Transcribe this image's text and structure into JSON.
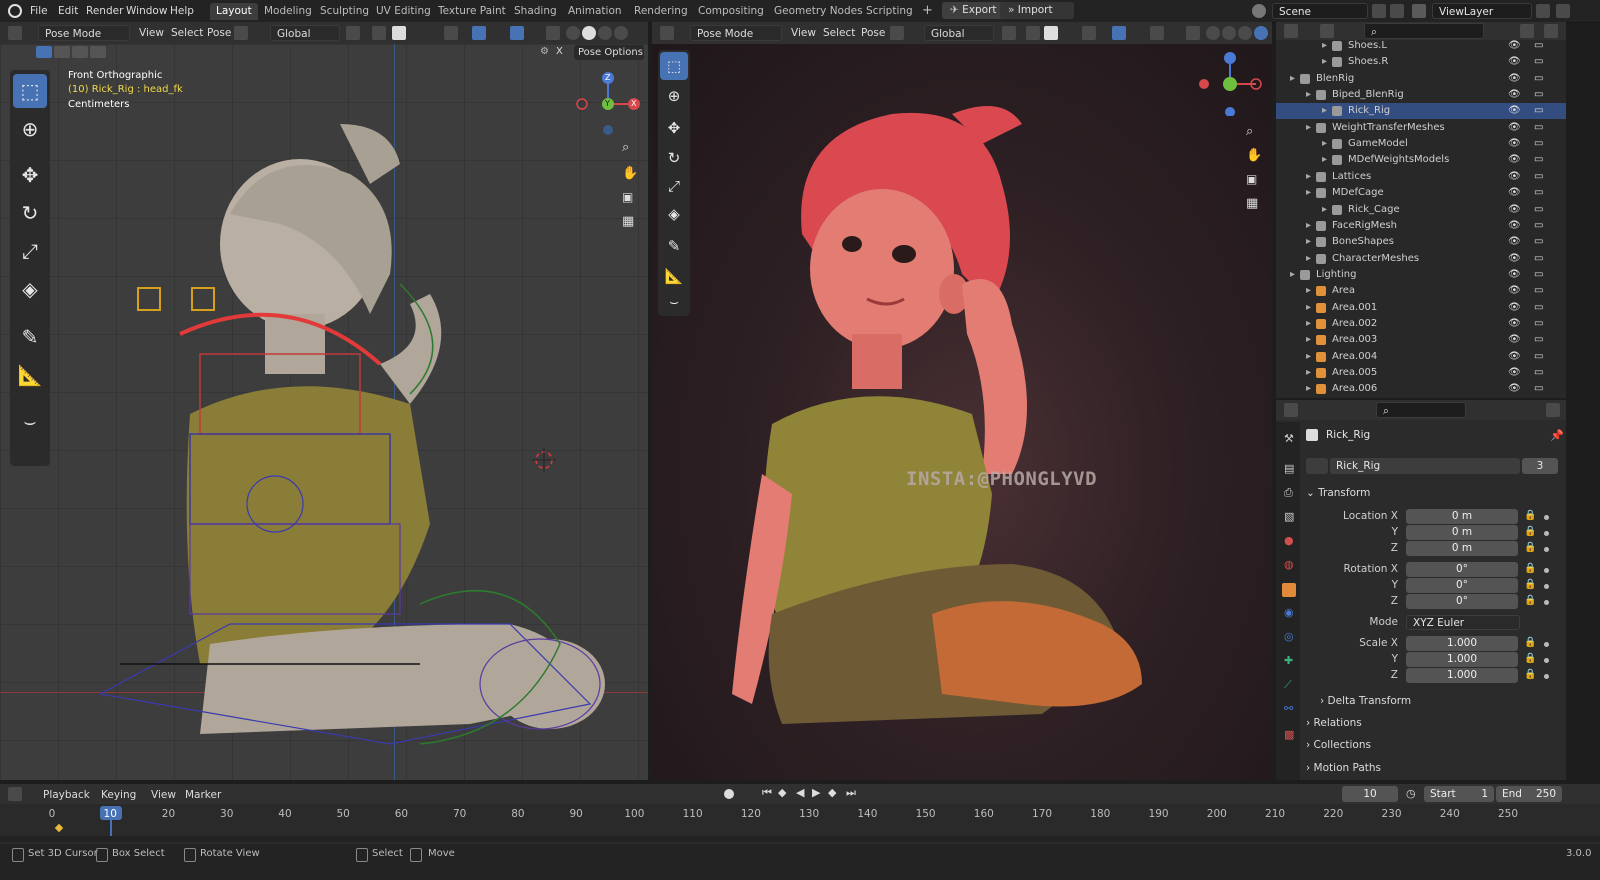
{
  "menu": [
    "File",
    "Edit",
    "Render",
    "Window",
    "Help"
  ],
  "workspaces": [
    "Layout",
    "Modeling",
    "Sculpting",
    "UV Editing",
    "Texture Paint",
    "Shading",
    "Animation",
    "Rendering",
    "Compositing",
    "Geometry Nodes",
    "Scripting"
  ],
  "export_label": "Export",
  "import_label": "Import",
  "scene": "Scene",
  "view_layer": "ViewLayer",
  "left_header": {
    "mode": "Pose Mode",
    "view": "View",
    "select": "Select",
    "pose": "Pose",
    "orientation": "Global"
  },
  "right_header": {
    "mode": "Pose Mode",
    "view": "View",
    "select": "Select",
    "pose": "Pose",
    "orientation": "Global"
  },
  "pose_options": "Pose Options",
  "viewport_info": {
    "view": "Front Orthographic",
    "object": "(10) Rick_Rig : head_fk",
    "units": "Centimeters"
  },
  "watermark": "INSTA:@PHONGLYVD",
  "gizmo": {
    "x": "X",
    "y": "Y",
    "z": "Z"
  },
  "outliner": [
    {
      "name": "Shoes.L",
      "indent": 3
    },
    {
      "name": "Shoes.R",
      "indent": 3
    },
    {
      "name": "BlenRig",
      "indent": 1
    },
    {
      "name": "Biped_BlenRig",
      "indent": 2
    },
    {
      "name": "Rick_Rig",
      "indent": 3,
      "selected": true
    },
    {
      "name": "WeightTransferMeshes",
      "indent": 2
    },
    {
      "name": "GameModel",
      "indent": 3
    },
    {
      "name": "MDefWeightsModels",
      "indent": 3
    },
    {
      "name": "Lattices",
      "indent": 2
    },
    {
      "name": "MDefCage",
      "indent": 2
    },
    {
      "name": "Rick_Cage",
      "indent": 3
    },
    {
      "name": "FaceRigMesh",
      "indent": 2
    },
    {
      "name": "BoneShapes",
      "indent": 2
    },
    {
      "name": "CharacterMeshes",
      "indent": 2
    },
    {
      "name": "Lighting",
      "indent": 1
    },
    {
      "name": "Area",
      "indent": 2
    },
    {
      "name": "Area.001",
      "indent": 2
    },
    {
      "name": "Area.002",
      "indent": 2
    },
    {
      "name": "Area.003",
      "indent": 2
    },
    {
      "name": "Area.004",
      "indent": 2
    },
    {
      "name": "Area.005",
      "indent": 2
    },
    {
      "name": "Area.006",
      "indent": 2
    }
  ],
  "properties": {
    "object_name": "Rick_Rig",
    "data_name": "Rick_Rig",
    "users": "3",
    "transform_label": "Transform",
    "location": {
      "label_x": "Location X",
      "label_y": "Y",
      "label_z": "Z",
      "x": "0 m",
      "y": "0 m",
      "z": "0 m"
    },
    "rotation": {
      "label_x": "Rotation X",
      "label_y": "Y",
      "label_z": "Z",
      "x": "0°",
      "y": "0°",
      "z": "0°"
    },
    "mode_label": "Mode",
    "mode_value": "XYZ Euler",
    "scale": {
      "label_x": "Scale X",
      "label_y": "Y",
      "label_z": "Z",
      "x": "1.000",
      "y": "1.000",
      "z": "1.000"
    },
    "delta_transform": "Delta Transform",
    "relations": "Relations",
    "collections": "Collections",
    "motion_paths": "Motion Paths"
  },
  "timeline": {
    "playback": "Playback",
    "keying": "Keying",
    "view": "View",
    "marker": "Marker",
    "current_frame": "10",
    "start_label": "Start",
    "start": "1",
    "end_label": "End",
    "end": "250",
    "ticks": [
      "0",
      "10",
      "20",
      "30",
      "40",
      "50",
      "60",
      "70",
      "80",
      "90",
      "100",
      "110",
      "120",
      "130",
      "140",
      "150",
      "160",
      "170",
      "180",
      "190",
      "200",
      "210",
      "220",
      "230",
      "240",
      "250"
    ]
  },
  "status": {
    "cursor": "Set 3D Cursor",
    "box": "Box Select",
    "rotate": "Rotate View",
    "select": "Select",
    "move": "Move",
    "version": "3.0.0"
  }
}
